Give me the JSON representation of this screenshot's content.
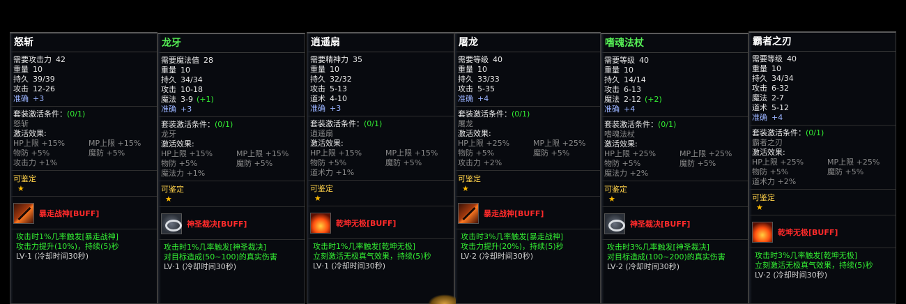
{
  "items": [
    {
      "name": "怒斩",
      "name_color": "#ffffff",
      "stats": [
        {
          "label": "需要攻击力",
          "value": "42"
        },
        {
          "label": "重量",
          "value": "10"
        },
        {
          "label": "持久",
          "value": "39/39"
        },
        {
          "label": "攻击",
          "value": "12-26"
        },
        {
          "label": "准确",
          "value": "+3",
          "style": "blue"
        }
      ],
      "set_condition": "套装激活条件：",
      "set_count": "(0/1)",
      "set_member": "怒斩",
      "set_effect_label": "激活效果:",
      "set_effects": [
        [
          "HP上限 +15%",
          "MP上限 +15%"
        ],
        [
          "物防 +5%",
          "魔防 +5%"
        ],
        [
          "攻击力 +1%",
          ""
        ]
      ],
      "appraisable": "可鉴定",
      "star": "★",
      "skill_icon": "sword-icon",
      "skill_name": "暴走战神[BUFF]",
      "skill_desc": [
        "攻击时1%几率触发[暴走战神]",
        "攻击力提升(10%)，持续(5)秒"
      ],
      "skill_cd": "LV·1 (冷却时间30秒)"
    },
    {
      "name": "龙牙",
      "name_color": "#55ee55",
      "stats": [
        {
          "label": "需要魔法值",
          "value": "28"
        },
        {
          "label": "重量",
          "value": "10"
        },
        {
          "label": "持久",
          "value": "34/34"
        },
        {
          "label": "攻击",
          "value": "10-18"
        },
        {
          "label": "魔法",
          "value": "3-9",
          "bonus": "(+1)"
        },
        {
          "label": "准确",
          "value": "+3",
          "style": "blue"
        }
      ],
      "set_condition": "套装激活条件：",
      "set_count": "(0/1)",
      "set_member": "龙牙",
      "set_effect_label": "激活效果:",
      "set_effects": [
        [
          "HP上限 +15%",
          "MP上限 +15%"
        ],
        [
          "物防 +5%",
          "魔防 +5%"
        ],
        [
          "魔法力 +1%",
          ""
        ]
      ],
      "appraisable": "可鉴定",
      "star": "★",
      "skill_icon": "ring-icon",
      "skill_name": "神圣裁决[BUFF]",
      "skill_desc": [
        "攻击时1%几率触发[神圣裁决]",
        "对目标造成(50~100)的真实伤害"
      ],
      "skill_cd": "LV·1 (冷却时间30秒)"
    },
    {
      "name": "逍遥扇",
      "name_color": "#ffffff",
      "stats": [
        {
          "label": "需要精神力",
          "value": "35"
        },
        {
          "label": "重量",
          "value": "10"
        },
        {
          "label": "持久",
          "value": "32/32"
        },
        {
          "label": "攻击",
          "value": "5-13"
        },
        {
          "label": "道术",
          "value": "4-10"
        },
        {
          "label": "准确",
          "value": "+3",
          "style": "blue"
        }
      ],
      "set_condition": "套装激活条件：",
      "set_count": "(0/1)",
      "set_member": "逍遥扇",
      "set_effect_label": "激活效果:",
      "set_effects": [
        [
          "HP上限 +15%",
          "MP上限 +15%"
        ],
        [
          "物防 +5%",
          "魔防 +5%"
        ],
        [
          "道术力 +1%",
          ""
        ]
      ],
      "appraisable": "可鉴定",
      "star": "★",
      "skill_icon": "flame-icon",
      "skill_name": "乾坤无极[BUFF]",
      "skill_desc": [
        "攻击时1%几率触发[乾坤无极]",
        "立刻激活无极真气效果，持续(5)秒"
      ],
      "skill_cd": "LV·1 (冷却时间30秒)"
    },
    {
      "name": "屠龙",
      "name_color": "#ffffff",
      "stats": [
        {
          "label": "需要等级",
          "value": "40"
        },
        {
          "label": "重量",
          "value": "10"
        },
        {
          "label": "持久",
          "value": "33/33"
        },
        {
          "label": "攻击",
          "value": "5-35"
        },
        {
          "label": "准确",
          "value": "+4",
          "style": "blue"
        }
      ],
      "set_condition": "套装激活条件：",
      "set_count": "(0/1)",
      "set_member": "屠龙",
      "set_effect_label": "激活效果:",
      "set_effects": [
        [
          "HP上限 +25%",
          "MP上限 +25%"
        ],
        [
          "物防 +5%",
          "魔防 +5%"
        ],
        [
          "攻击力 +2%",
          ""
        ]
      ],
      "appraisable": "可鉴定",
      "star": "★",
      "skill_icon": "sword-icon",
      "skill_name": "暴走战神[BUFF]",
      "skill_desc": [
        "攻击时3%几率触发[暴走战神]",
        "攻击力提升(20%)，持续(5)秒"
      ],
      "skill_cd": "LV·2 (冷却时间30秒)"
    },
    {
      "name": "嗜魂法杖",
      "name_color": "#55ee55",
      "stats": [
        {
          "label": "需要等级",
          "value": "40"
        },
        {
          "label": "重量",
          "value": "10"
        },
        {
          "label": "持久",
          "value": "14/14"
        },
        {
          "label": "攻击",
          "value": "6-13"
        },
        {
          "label": "魔法",
          "value": "2-12",
          "bonus": "(+2)"
        },
        {
          "label": "准确",
          "value": "+4",
          "style": "blue"
        }
      ],
      "set_condition": "套装激活条件：",
      "set_count": "(0/1)",
      "set_member": "嗜魂法杖",
      "set_effect_label": "激活效果:",
      "set_effects": [
        [
          "HP上限 +25%",
          "MP上限 +25%"
        ],
        [
          "物防 +5%",
          "魔防 +5%"
        ],
        [
          "魔法力 +2%",
          ""
        ]
      ],
      "appraisable": "可鉴定",
      "star": "★",
      "skill_icon": "ring-icon",
      "skill_name": "神圣裁决[BUFF]",
      "skill_desc": [
        "攻击时3%几率触发[神圣裁决]",
        "对目标造成(100~200)的真实伤害"
      ],
      "skill_cd": "LV·2 (冷却时间30秒)"
    },
    {
      "name": "霸者之刃",
      "name_color": "#ffffff",
      "stats": [
        {
          "label": "需要等级",
          "value": "40"
        },
        {
          "label": "重量",
          "value": "10"
        },
        {
          "label": "持久",
          "value": "34/34"
        },
        {
          "label": "攻击",
          "value": "6-32"
        },
        {
          "label": "魔法",
          "value": "2-7"
        },
        {
          "label": "道术",
          "value": "5-12"
        },
        {
          "label": "准确",
          "value": "+4",
          "style": "blue"
        }
      ],
      "set_condition": "套装激活条件：",
      "set_count": "(0/1)",
      "set_member": "霸者之刃",
      "set_effect_label": "激活效果:",
      "set_effects": [
        [
          "HP上限 +25%",
          "MP上限 +25%"
        ],
        [
          "物防 +5%",
          "魔防 +5%"
        ],
        [
          "道术力 +2%",
          ""
        ]
      ],
      "appraisable": "可鉴定",
      "star": "★",
      "skill_icon": "flame-icon",
      "skill_name": "乾坤无极[BUFF]",
      "skill_desc": [
        "攻击时3%几率触发[乾坤无极]",
        "立刻激活无极真气效果，持续(5)秒"
      ],
      "skill_cd": "LV·2 (冷却时间30秒)"
    }
  ]
}
